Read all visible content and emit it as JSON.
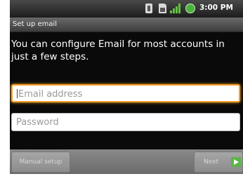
{
  "status_bar": {
    "time": "3:00 PM",
    "icons": [
      "usb-icon",
      "sd-card-icon",
      "signal-icon",
      "battery-icon"
    ],
    "signal_color": "#64c040",
    "battery_color": "#49b43b"
  },
  "title_bar": {
    "title": "Set up email"
  },
  "main": {
    "instructions": "You can configure Email for most accounts in just a few steps.",
    "email_field": {
      "value": "",
      "placeholder": "Email address",
      "focused": true,
      "focus_color": "#f5a02a"
    },
    "password_field": {
      "value": "",
      "placeholder": "Password"
    }
  },
  "bottom_bar": {
    "manual_setup_label": "Manual setup",
    "next_label": "Next",
    "next_icon": "next-arrow-icon",
    "next_icon_color": "#5bb548"
  }
}
